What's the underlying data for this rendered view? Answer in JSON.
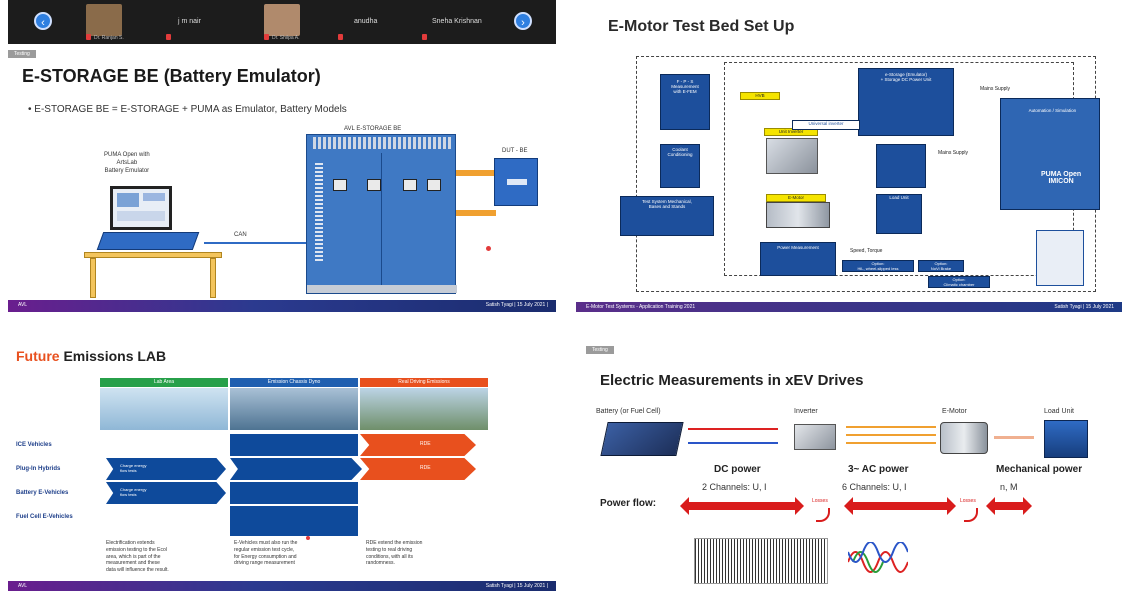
{
  "slide1": {
    "participants": [
      {
        "name": "Dr. Ranjan S.",
        "caption": "Dr. Ranjan S."
      },
      {
        "name": "j m nair",
        "caption": ""
      },
      {
        "name": "Dr. Shilpa A.",
        "caption": "Dr. Shilpa A."
      },
      {
        "name": "anudha",
        "caption": ""
      },
      {
        "name": "Sneha Krishnan",
        "caption": ""
      }
    ],
    "section_tag": "Testing",
    "title": "E-STORAGE BE (Battery Emulator)",
    "bullet": "E-STORAGE BE = E-STORAGE + PUMA as Emulator, Battery Models",
    "puma_label": "PUMA Open with\nArtsLab\nBattery Emulator",
    "cabinet_label": "AVL E-STORAGE BE",
    "dut_label": "DUT - BE",
    "can_label": "CAN",
    "footer_left": "AVL",
    "footer_right": "Satish Tyagi | 15 July 2021 |"
  },
  "slide2": {
    "title": "E-Motor Test Bed Set Up",
    "labels": {
      "ftp": "F - P - S\nMeasurement\nwith E-FEM",
      "estorage": "e-Storage (Emulator)\n+ Storage DC Power Unit",
      "mains1": "Mains Supply",
      "simulator": "Automation / Simulation",
      "conditioning": "Coolant\nConditioning",
      "inverter": "Unit Inverter",
      "inverter2": "Universal inverter",
      "mains2": "Mains Supply",
      "emotor": "E-Motor",
      "loadunit": "Load Unit",
      "testsystem": "Test System Mechanical,\nBases and Stands",
      "power": "Power Measurement",
      "speed": "Speed, Torque",
      "option1": "Option:\nHiL, wheel-slipped less",
      "option2": "Option:\nNoVi Brake",
      "option3": "Option:\nClimatic chamber",
      "puma": "PUMA Open\nIMICON",
      "hv": "HVB",
      "footer_left": "E-Motor Test Systems - Application Training 2021",
      "footer_right": "Satish Tyagi | 15 July 2021"
    }
  },
  "slide3": {
    "title_accent": "Future",
    "title_rest": " Emissions LAB",
    "headers": [
      "Lab Area",
      "Emission Chassis Dyno",
      "Real Driving Emissions"
    ],
    "rows": [
      "ICE Vehicles",
      "Plug-In Hybrids",
      "Battery E-Vehicles",
      "Fuel Cell E-Vehicles"
    ],
    "charge_label": "Charge energy\nflow tests",
    "rde_label": "RDE",
    "notes": [
      "Electrification extends\nemission testing to the Ecol\narea, which is part of the\nmeasurement and these\ndata will influence the result.",
      "E-Vehicles must also run the\nregular emission test cycle,\nfor Energy consumption and\ndriving range measurement",
      "RDE extend the emission\ntesting to real driving\nconditions, with all its\nrandomness."
    ],
    "footer_left": "AVL",
    "footer_right": "Satish Tyagi | 15 July 2021 |"
  },
  "slide4": {
    "section_tag": "Testing",
    "title": "Electric Measurements in xEV Drives",
    "components": [
      "Battery (or Fuel Cell)",
      "Inverter",
      "E-Motor",
      "Load Unit"
    ],
    "powers": [
      "DC power",
      "3~ AC power",
      "Mechanical power"
    ],
    "channels": [
      "2 Channels: U, I",
      "6 Channels: U, I",
      "n, M"
    ],
    "power_flow": "Power flow:",
    "losses": [
      "Losses",
      "Losses"
    ]
  }
}
